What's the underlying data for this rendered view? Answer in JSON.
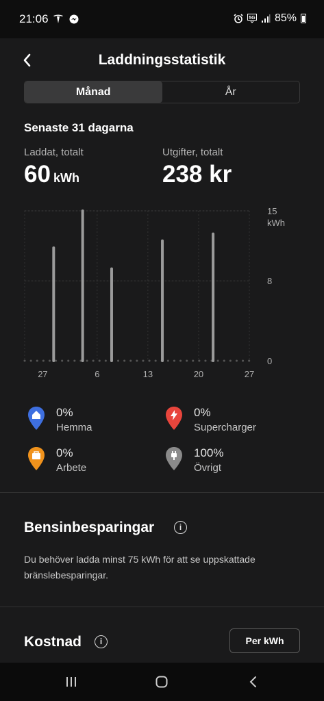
{
  "status_bar": {
    "time": "21:06",
    "left_icons": [
      "tesla-icon",
      "messenger-icon"
    ],
    "right_icons": [
      "alarm-icon",
      "5g-icon",
      "signal-icon"
    ],
    "battery": "85%"
  },
  "header": {
    "title": "Laddningsstatistik",
    "back_icon": "chevron-left-icon"
  },
  "tabs": [
    {
      "label": "Månad",
      "active": true
    },
    {
      "label": "År",
      "active": false
    }
  ],
  "period": "Senaste 31 dagarna",
  "stats": {
    "charged_label": "Laddat, totalt",
    "charged_value": "60",
    "charged_unit": "kWh",
    "cost_label": "Utgifter, totalt",
    "cost_value": "238 kr"
  },
  "chart_data": {
    "type": "bar",
    "x_tick_labels": [
      "27",
      "6",
      "13",
      "20",
      "27"
    ],
    "y_tick_labels": [
      "15",
      "8",
      "0"
    ],
    "y_unit": "kWh",
    "ylim": [
      0,
      15
    ],
    "bar_color": "#9b9b9b",
    "bars": [
      {
        "day": 4,
        "value": 11.3
      },
      {
        "day": 8,
        "value": 15.0
      },
      {
        "day": 12,
        "value": 9.2
      },
      {
        "day": 19,
        "value": 12.0
      },
      {
        "day": 26,
        "value": 12.7
      }
    ]
  },
  "legend": [
    {
      "pct": "0%",
      "name": "Hemma",
      "icon": "home-pin-icon",
      "color": "#3e6fe0"
    },
    {
      "pct": "0%",
      "name": "Supercharger",
      "icon": "supercharger-pin-icon",
      "color": "#e8453c"
    },
    {
      "pct": "0%",
      "name": "Arbete",
      "icon": "work-pin-icon",
      "color": "#f0921c"
    },
    {
      "pct": "100%",
      "name": "Övrigt",
      "icon": "plug-pin-icon",
      "color": "#8a8a8a"
    }
  ],
  "savings": {
    "title": "Bensinbesparingar",
    "body": "Du behöver ladda minst 75 kWh för att se uppskattade bränslebesparingar."
  },
  "cost": {
    "title": "Kostnad",
    "button_label": "Per kWh"
  }
}
